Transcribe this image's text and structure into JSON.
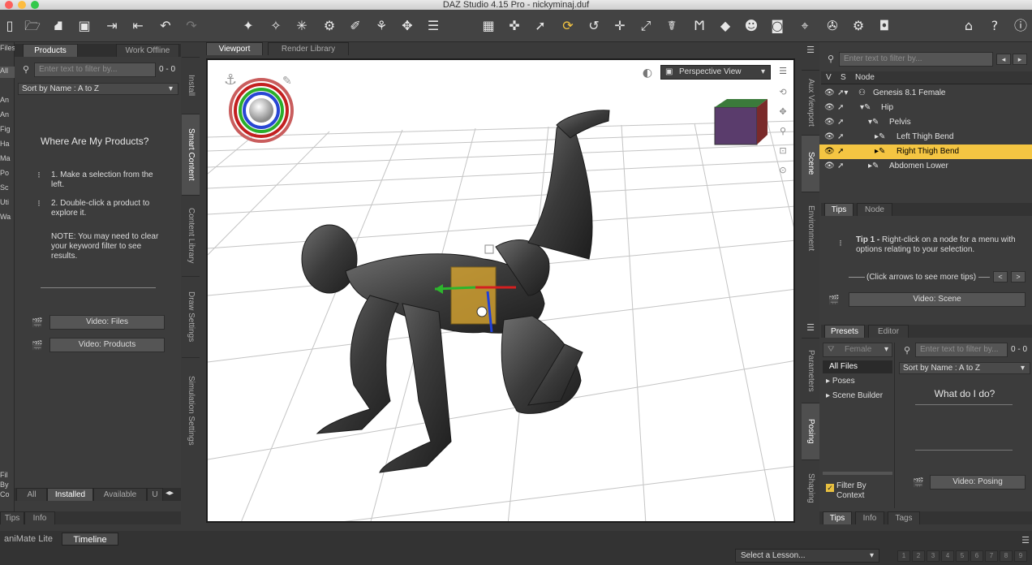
{
  "window": {
    "title": "DAZ Studio 4.15 Pro - nickyminaj.duf"
  },
  "left_panel": {
    "tabs": [
      "Files",
      "Products",
      "Work Offline"
    ],
    "active_tab": "Products",
    "filter_placeholder": "Enter text to filter by...",
    "filter_count": "0 - 0",
    "sort": "Sort by Name : A to Z",
    "strip_items": [
      "All",
      "An",
      "An",
      "Fig",
      "Ha",
      "Ma",
      "Po",
      "Sc",
      "Uti",
      "Wa",
      "Fil",
      "By",
      "Co"
    ],
    "help_title": "Where Are My Products?",
    "step1": "1. Make a selection from the left.",
    "step2": "2. Double-click a product to explore it.",
    "note": "NOTE: You may need to clear your keyword filter to see results.",
    "video_files": "Video: Files",
    "video_products": "Video: Products",
    "bottom_tabs": [
      "All",
      "Installed",
      "Available",
      "U"
    ],
    "active_bottom_tab": "Installed",
    "footer_tabs": [
      "Tips",
      "Info"
    ]
  },
  "left_vertical_tabs": [
    "Install",
    "Smart Content",
    "Content Library",
    "Draw Settings",
    "Simulation Settings"
  ],
  "viewport": {
    "tabs": [
      "Viewport",
      "Render Library"
    ],
    "view_mode": "Perspective View"
  },
  "right_vertical_tabs": [
    "Aux Viewport",
    "Scene",
    "Environment",
    "Parameters",
    "Posing",
    "Shaping"
  ],
  "scene": {
    "filter_placeholder": "Enter text to filter by...",
    "columns": [
      "V",
      "S",
      "Node"
    ],
    "nodes": [
      {
        "label": "Genesis 8.1 Female",
        "depth": 0,
        "selected": false
      },
      {
        "label": "Hip",
        "depth": 1,
        "selected": false
      },
      {
        "label": "Pelvis",
        "depth": 2,
        "selected": false
      },
      {
        "label": "Left Thigh Bend",
        "depth": 3,
        "selected": false
      },
      {
        "label": "Right Thigh Bend",
        "depth": 3,
        "selected": true
      },
      {
        "label": "Abdomen Lower",
        "depth": 2,
        "selected": false
      }
    ]
  },
  "tips": {
    "tabs": [
      "Tips",
      "Node"
    ],
    "tip_title": "Tip 1 -",
    "tip_text": "Right-click on a node for a menu with options relating to your selection.",
    "nav_hint": "(Click arrows to see more tips)",
    "prev": "<",
    "next": ">",
    "video": "Video: Scene"
  },
  "presets": {
    "tabs": [
      "Presets",
      "Editor"
    ],
    "category": "Female",
    "tree": [
      "All Files",
      "Poses",
      "Scene Builder"
    ],
    "filter_placeholder": "Enter text to filter by...",
    "filter_count": "0 - 0",
    "sort": "Sort by Name : A to Z",
    "help": "What do I do?",
    "filter_by_context": "Filter By Context",
    "video": "Video: Posing",
    "footer_tabs": [
      "Tips",
      "Info",
      "Tags"
    ]
  },
  "bottom": {
    "tabs": [
      "aniMate Lite",
      "Timeline"
    ],
    "active": "Timeline",
    "lesson": "Select a Lesson...",
    "numbers": [
      "1",
      "2",
      "3",
      "4",
      "5",
      "6",
      "7",
      "8",
      "9"
    ]
  },
  "colors": {
    "selected": "#f4c542",
    "panel": "#3c3c3c"
  }
}
